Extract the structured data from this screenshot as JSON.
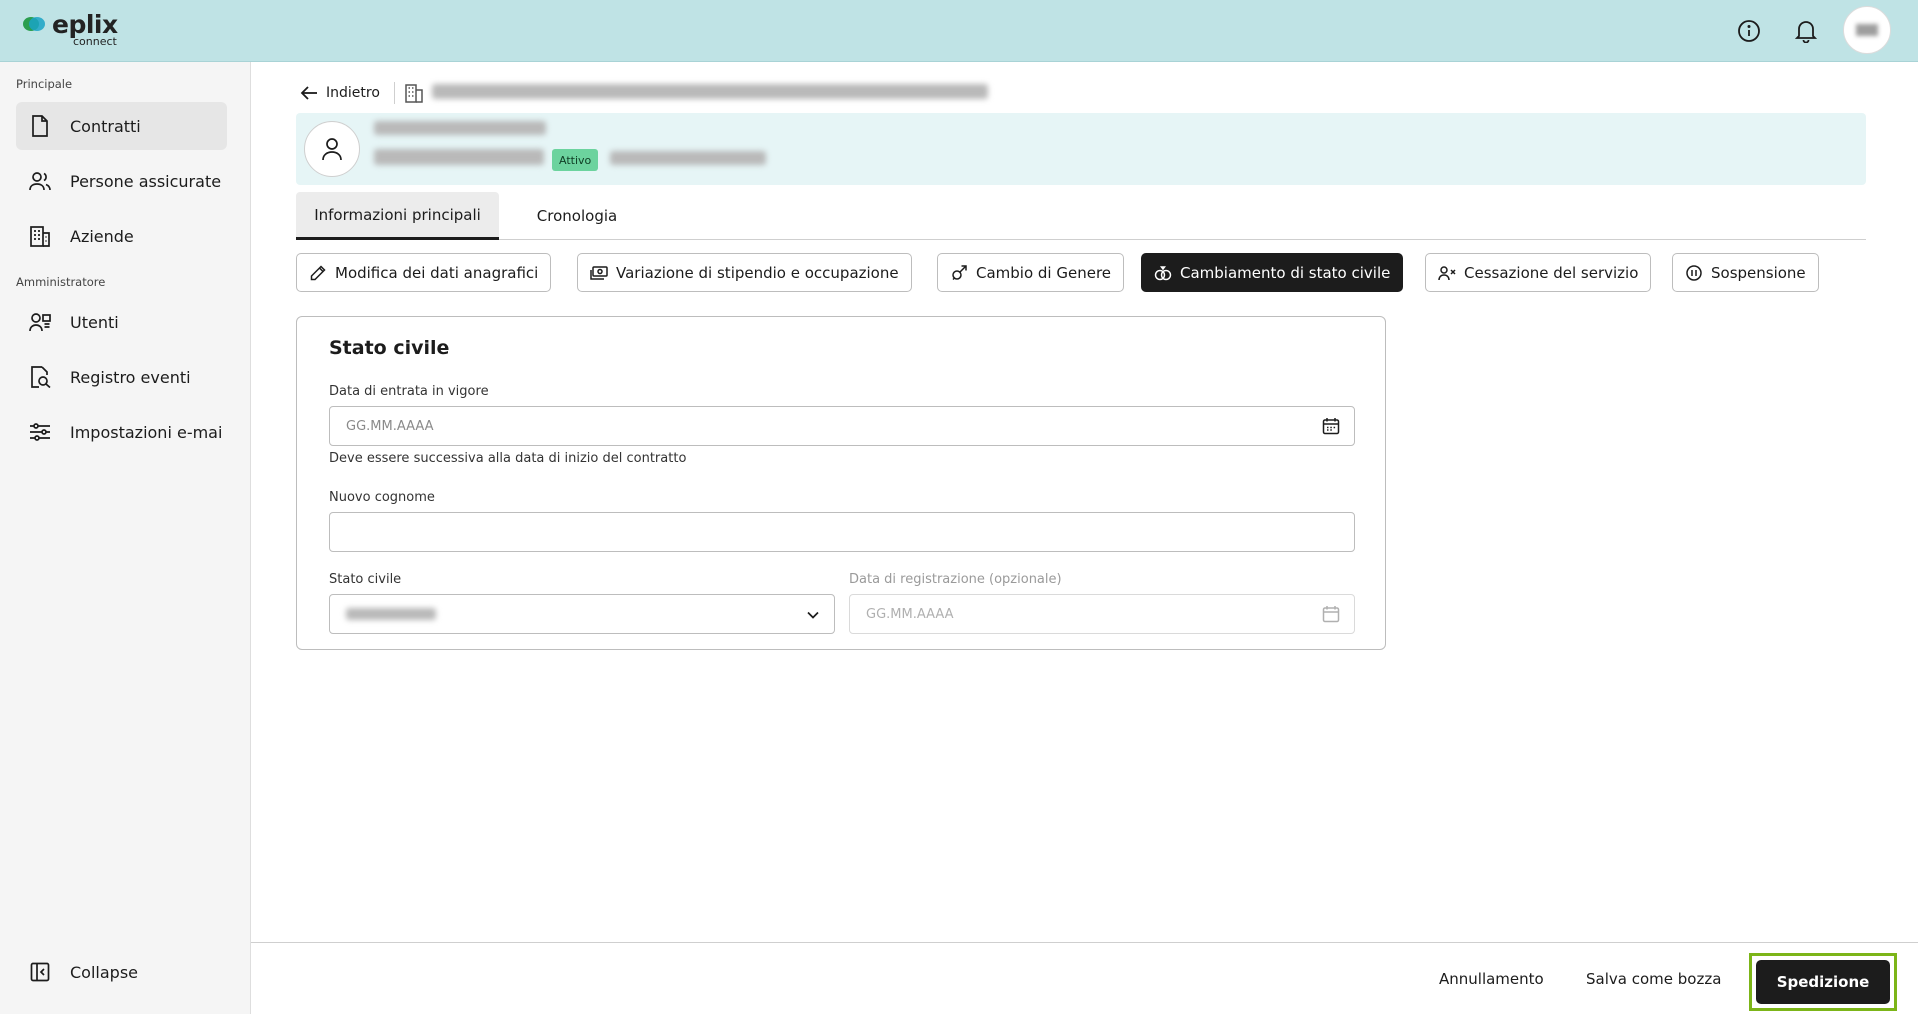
{
  "app": {
    "brand": "eplix",
    "brand_sub": "connect",
    "colors": {
      "topbar": "#bfe3e5",
      "accent_green": "#7cb518",
      "badge_green": "#6cd39e",
      "dark": "#1c1c1c"
    }
  },
  "topbar": {
    "icons": [
      "info-icon",
      "bell-icon",
      "user-avatar"
    ]
  },
  "sidebar": {
    "section_principal": "Principale",
    "section_admin": "Amministratore",
    "items_principal": [
      {
        "label": "Contratti",
        "icon": "document-icon",
        "active": true
      },
      {
        "label": "Persone assicurate",
        "icon": "people-icon"
      },
      {
        "label": "Aziende",
        "icon": "building-icon"
      }
    ],
    "items_admin": [
      {
        "label": "Utenti",
        "icon": "users-icon"
      },
      {
        "label": "Registro eventi",
        "icon": "search-document-icon"
      },
      {
        "label": "Impostazioni e-mai",
        "icon": "sliders-icon"
      }
    ],
    "collapse_label": "Collapse"
  },
  "header": {
    "back_label": "Indietro",
    "status_badge": "Attivo"
  },
  "tabs": [
    {
      "label": "Informazioni principali",
      "active": true
    },
    {
      "label": "Cronologia"
    }
  ],
  "actions": [
    {
      "label": "Modifica dei dati anagrafici",
      "icon": "pencil-icon"
    },
    {
      "label": "Variazione di stipendio e occupazione",
      "icon": "money-icon"
    },
    {
      "label": "Cambio di Genere",
      "icon": "gender-icon"
    },
    {
      "label": "Cambiamento di stato civile",
      "icon": "rings-icon",
      "active": true
    },
    {
      "label": "Cessazione del servizio",
      "icon": "user-remove-icon"
    },
    {
      "label": "Sospensione",
      "icon": "pause-icon"
    }
  ],
  "form": {
    "title": "Stato civile",
    "effective_date_label": "Data di entrata in vigore",
    "effective_date_placeholder": "GG.MM.AAAA",
    "effective_date_helper": "Deve essere successiva alla data di inizio del contratto",
    "new_surname_label": "Nuovo cognome",
    "new_surname_value": "",
    "marital_status_label": "Stato civile",
    "registration_date_label": "Data di registrazione (opzionale)",
    "registration_date_placeholder": "GG.MM.AAAA"
  },
  "footer": {
    "cancel_label": "Annullamento",
    "draft_label": "Salva come bozza",
    "submit_label": "Spedizione"
  }
}
